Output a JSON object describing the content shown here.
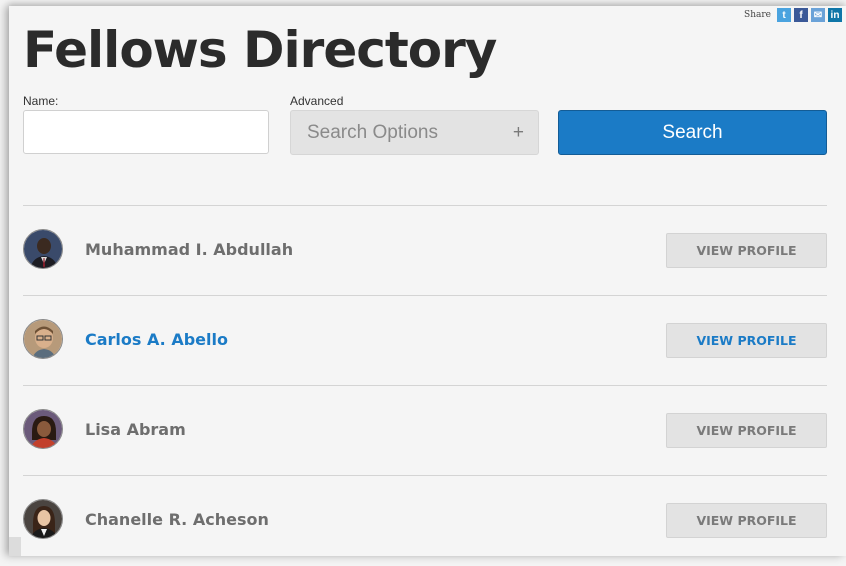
{
  "share": {
    "label": "Share",
    "twitter": "t",
    "facebook": "f",
    "email": "✉",
    "linkedin": "in"
  },
  "page_title": "Fellows Directory",
  "search": {
    "name_label": "Name:",
    "name_value": "",
    "advanced_label": "Advanced",
    "advanced_button": "Search Options",
    "advanced_plus": "+",
    "search_button": "Search"
  },
  "fellows": [
    {
      "name": "Muhammad I. Abdullah",
      "button": "VIEW PROFILE"
    },
    {
      "name": "Carlos A. Abello",
      "button": "VIEW PROFILE"
    },
    {
      "name": "Lisa Abram",
      "button": "VIEW PROFILE"
    },
    {
      "name": "Chanelle R. Acheson",
      "button": "VIEW PROFILE"
    }
  ],
  "colors": {
    "accent": "#1b7bc6",
    "twitter": "#4aa3df",
    "facebook": "#3b5998",
    "email": "#6aa2d8",
    "linkedin": "#0e76a8"
  }
}
